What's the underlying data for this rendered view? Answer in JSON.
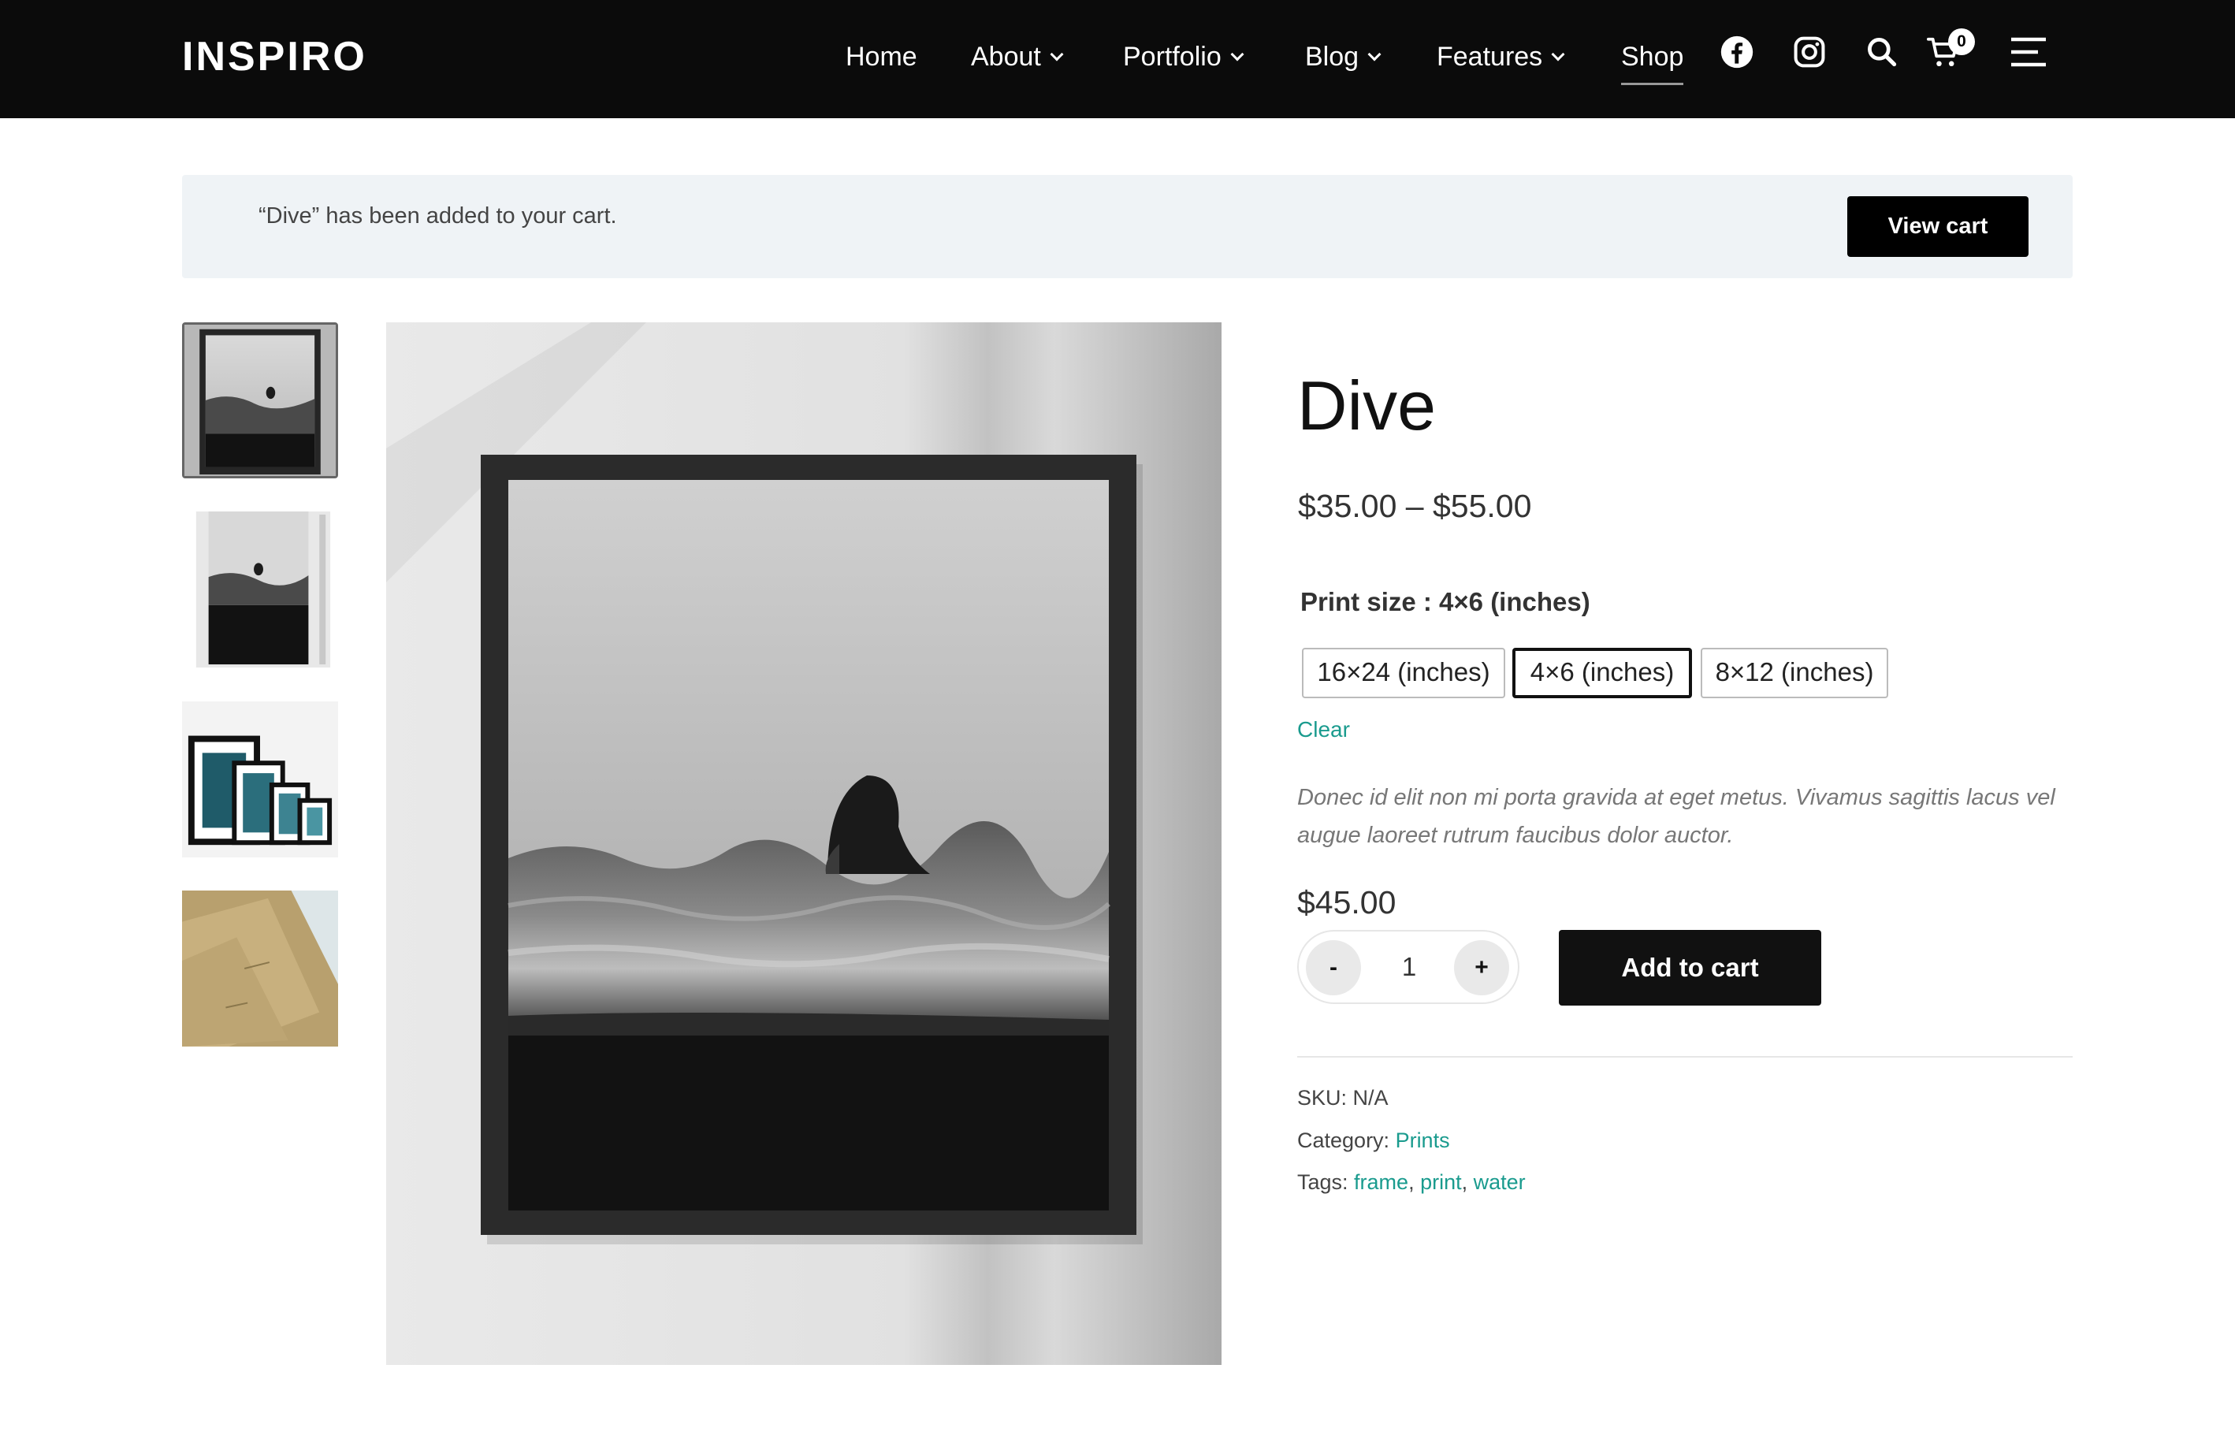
{
  "header": {
    "logo": "INSPIRO",
    "nav": {
      "home": "Home",
      "about": "About",
      "portfolio": "Portfolio",
      "blog": "Blog",
      "features": "Features",
      "shop": "Shop"
    },
    "icons": [
      "facebook-icon",
      "instagram-icon",
      "search-icon",
      "cart-icon",
      "menu-icon"
    ],
    "cart_count": "0"
  },
  "notice": {
    "message": "“Dive” has been added to your cart.",
    "button": "View cart"
  },
  "gallery": {
    "thumbnails": [
      "framed print front",
      "framed print unframed",
      "multiple frames",
      "kraft paper prints"
    ],
    "active_index": 0
  },
  "product": {
    "title": "Dive",
    "price_range": "$35.00 – $55.00",
    "attribute": {
      "label": "Print size",
      "separator": " : ",
      "selected": "4×6 (inches)",
      "options": [
        "16×24 (inches)",
        "4×6 (inches)",
        "8×12 (inches)"
      ]
    },
    "clear": "Clear",
    "description": "Donec id elit non mi porta gravida at eget metus. Vivamus sagittis lacus vel augue laoreet rutrum faucibus dolor auctor.",
    "variation_price": "$45.00",
    "quantity": {
      "minus": "-",
      "value": "1",
      "plus": "+"
    },
    "add_to_cart": "Add to cart",
    "meta": {
      "sku_label": "SKU: ",
      "sku_value": "N/A",
      "category_label": "Category: ",
      "category": "Prints",
      "tags_label": "Tags: ",
      "tags": [
        "frame",
        "print",
        "water"
      ],
      "tag_separator": ", "
    }
  },
  "colors": {
    "header_bg": "#0b0b0b",
    "accent": "#1a9b8e",
    "notice_bg": "#eff3f6",
    "button_bg": "#111111"
  }
}
